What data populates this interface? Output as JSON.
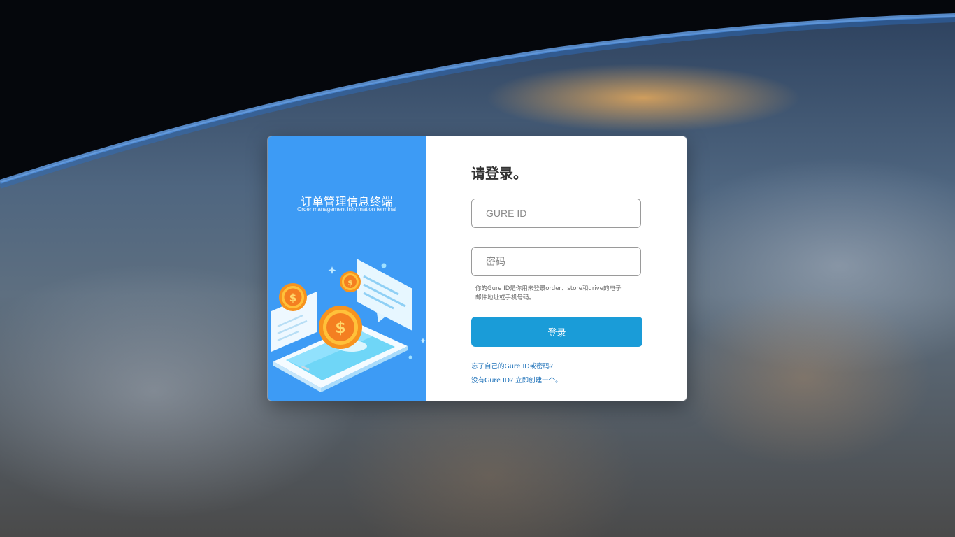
{
  "brand": {
    "title": "订单管理信息终端",
    "subtitle": "Order management information terminal"
  },
  "login": {
    "heading": "请登录。",
    "id_placeholder": "GURE ID",
    "password_placeholder": "密码",
    "hint": "你的Gure ID是你用来登录order、store和drive的电子邮件地址或手机号码。",
    "submit_label": "登录",
    "forgot_link": "忘了自己的Gure ID或密码?",
    "create_link": "没有Gure ID? 立即创建一个。"
  },
  "colors": {
    "brand_blue": "#3d9bf5",
    "button_blue": "#1a9cd8",
    "link_blue": "#1a6fb8"
  }
}
